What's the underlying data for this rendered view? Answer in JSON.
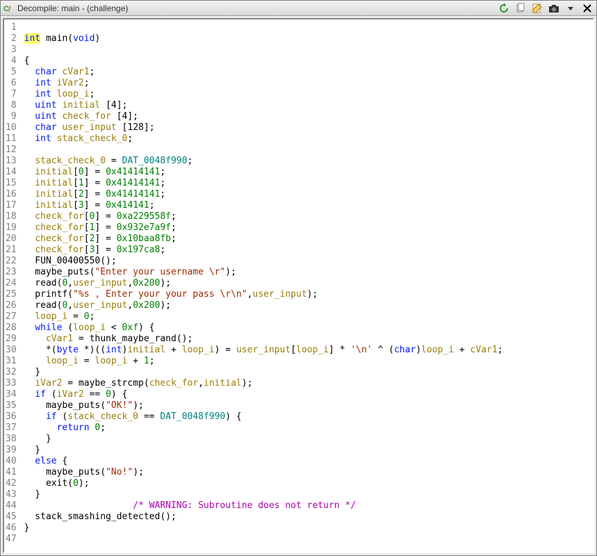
{
  "window": {
    "title": "Decompile: main -  (challenge)"
  },
  "icons": {
    "app": "Cf",
    "refresh": "⟳",
    "copy": "⧉",
    "edit": "✎",
    "snapshot": "📷",
    "menu": "▾",
    "close": "✕"
  },
  "code": {
    "lines": 47,
    "fn_sig_kw": "int",
    "fn_name": "main",
    "fn_param_kw": "void",
    "decl_char": "char",
    "decl_int": "int",
    "decl_uint": "uint",
    "v_cVar1": "cVar1",
    "v_iVar2": "iVar2",
    "v_loop_i": "loop_i",
    "v_initial": "initial",
    "v_check_for": "check_for",
    "v_user_input": "user_input",
    "v_stack_check_0": "stack_check_0",
    "arr4": "[4]",
    "arr128": "[128]",
    "g_DAT": "DAT_0048f990",
    "hex": {
      "init0": "0x41414141",
      "init1": "0x41414141",
      "init2": "0x41414141",
      "init3": "0x414141",
      "chk0": "0xa229558f",
      "chk1": "0x932e7a9f",
      "chk2": "0x10baa8fb",
      "chk3": "0x197ca8",
      "oxf": "0xf",
      "ox200a": "0x200",
      "ox200b": "0x200",
      "zero": "0"
    },
    "fn": {
      "FUN": "FUN_00400550",
      "maybe_puts": "maybe_puts",
      "read": "read",
      "printf": "printf",
      "thunk": "thunk_maybe_rand",
      "strcmp": "maybe_strcmp",
      "exit": "exit",
      "ssd": "stack_smashing_detected"
    },
    "str": {
      "enter_user": "\"Enter your username \\r\"",
      "enter_pass": "\"%s , Enter your your pass \\r\\n\"",
      "ok": "\"OK!\"",
      "no": "\"No!\"",
      "nl": "'\\n'"
    },
    "kw": {
      "while": "while",
      "if": "if",
      "else": "else",
      "return": "return",
      "byte": "byte",
      "int_cast": "int",
      "char_cast": "char"
    },
    "comment_warn": "/* WARNING: Subroutine does not return */"
  }
}
